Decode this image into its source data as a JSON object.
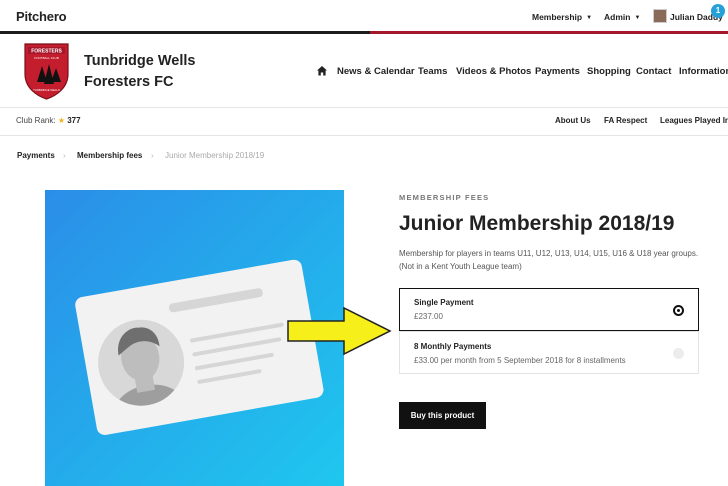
{
  "topbar": {
    "logo": "Pitchero",
    "membership_label": "Membership",
    "admin_label": "Admin",
    "user_name": "Julian Daddy",
    "notification_count": "1"
  },
  "club": {
    "name_line1": "Tunbridge Wells",
    "name_line2": "Foresters FC",
    "crest_text": "FORESTERS",
    "crest_sub": "FOOTBALL CLUB",
    "crest_bottom": "TUNBRIDGE WELLS"
  },
  "nav": {
    "items": [
      "News & Calendar",
      "Teams",
      "Videos & Photos",
      "Payments",
      "Shopping",
      "Contact",
      "Information"
    ]
  },
  "subbar": {
    "rank_label": "Club Rank:",
    "rank_value": "377",
    "links": [
      "About Us",
      "FA Respect",
      "Leagues Played In"
    ]
  },
  "breadcrumb": {
    "items": [
      "Payments",
      "Membership fees",
      "Junior Membership 2018/19"
    ],
    "separator": "›"
  },
  "product": {
    "category": "MEMBERSHIP FEES",
    "title": "Junior Membership 2018/19",
    "description": "Membership for players in teams U11, U12, U13, U14, U15, U16 & U18 year groups. (Not in a Kent Youth League team)",
    "options": [
      {
        "name": "Single Payment",
        "price": "£237.00",
        "selected": true
      },
      {
        "name": "8 Monthly Payments",
        "price": "£33.00 per month from 5 September 2018 for 8 installments",
        "selected": false
      }
    ],
    "buy_label": "Buy this product"
  },
  "colors": {
    "brand_red": "#a4172b",
    "accent_blue": "#25a0d9",
    "arrow_yellow": "#f7ef1a",
    "image_gradient_start": "#2a8ee8",
    "image_gradient_end": "#1fc7ee"
  },
  "icons": {
    "home": "home-icon",
    "star": "star-icon",
    "radio_selected": "radio-selected-icon",
    "radio_unselected": "radio-unselected-icon"
  }
}
